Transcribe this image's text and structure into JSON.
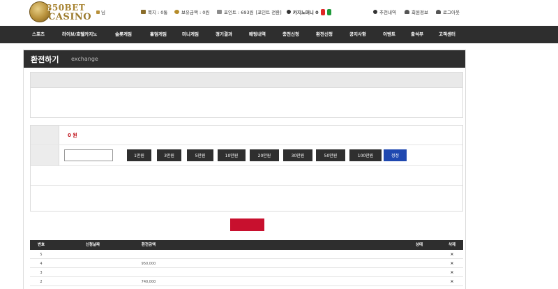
{
  "header": {
    "logo_text_top": "850BET",
    "logo_text_bottom": "CASINO",
    "user_name": "",
    "user_suffix": "님",
    "mail_label": "쪽지 : 0통",
    "money_label": "보유금액 : 0원",
    "point_label": "포인트 : 693원",
    "point_convert": "[포인트 전환]",
    "casino_money_label": "카지노머니 0",
    "badge_convert": "",
    "badge_withdraw": "",
    "recommend_label": "추천내역",
    "member_info_label": "회원정보",
    "logout_label": "로그아웃"
  },
  "nav": {
    "items": [
      "스포츠",
      "라이브/호텔카지노",
      "슬롯게임",
      "홀덤게임",
      "미니게임",
      "경기결과",
      "배팅내역",
      "충전신청",
      "환전신청",
      "공지사항",
      "이벤트",
      "출석부",
      "고객센터"
    ]
  },
  "panel": {
    "title": "환전하기",
    "subtitle": "exchange",
    "notice_title": "",
    "notice_lines": [
      "",
      "",
      "",
      "",
      ""
    ],
    "holding_label": "",
    "holding_value": "0 원",
    "amount_label": "",
    "amount_value": "",
    "amount_buttons": [
      "1만원",
      "3만원",
      "5만원",
      "10만원",
      "20만원",
      "30만원",
      "50만원",
      "100만원"
    ],
    "reset_label": "정정",
    "warning": "",
    "account_lines": [
      "",
      "",
      ""
    ],
    "submit_label": ""
  },
  "table": {
    "headers": [
      "번호",
      "신청날짜",
      "환전금액",
      "",
      "",
      "",
      "상태",
      "삭제"
    ],
    "rows": [
      {
        "no": "5",
        "date": "",
        "amount": "",
        "account": "",
        "holder": "",
        "processed": "",
        "status": "",
        "del": "×"
      },
      {
        "no": "4",
        "date": "",
        "amount": "950,000",
        "account": "",
        "holder": "",
        "processed": "",
        "status": "",
        "del": "×"
      },
      {
        "no": "3",
        "date": "",
        "amount": "",
        "account": "",
        "holder": "",
        "processed": "",
        "status": "",
        "del": "×"
      },
      {
        "no": "2",
        "date": "",
        "amount": "740,000",
        "account": "",
        "holder": "",
        "processed": "",
        "status": "",
        "del": "×"
      }
    ]
  }
}
